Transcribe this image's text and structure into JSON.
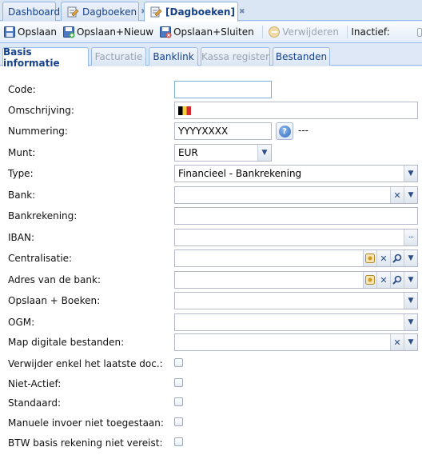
{
  "top_tabs": [
    {
      "label": "Dashboard"
    },
    {
      "label": "Dagboeken"
    },
    {
      "label": "[Dagboeken]"
    }
  ],
  "toolbar": {
    "save_label": "Opslaan",
    "save_new_label": "Opslaan+Nieuw",
    "save_close_label": "Opslaan+Sluiten",
    "delete_label": "Verwijderen",
    "inactive_label": "Inactief:"
  },
  "sub_tabs": [
    {
      "label": "Basis informatie"
    },
    {
      "label": "Facturatie"
    },
    {
      "label": "Banklink"
    },
    {
      "label": "Kassa register"
    },
    {
      "label": "Bestanden"
    }
  ],
  "form": {
    "code": {
      "label": "Code:",
      "value": ""
    },
    "omschrijving": {
      "label": "Omschrijving:",
      "value": ""
    },
    "nummering": {
      "label": "Nummering:",
      "value": "YYYYXXXX",
      "suffix": "---"
    },
    "munt": {
      "label": "Munt:",
      "value": "EUR"
    },
    "type": {
      "label": "Type:",
      "value": "Financieel - Bankrekening"
    },
    "bank": {
      "label": "Bank:",
      "value": ""
    },
    "bankrekening": {
      "label": "Bankrekening:",
      "value": ""
    },
    "iban": {
      "label": "IBAN:",
      "value": ""
    },
    "centralisatie": {
      "label": "Centralisatie:",
      "value": ""
    },
    "adres_bank": {
      "label": "Adres van de bank:",
      "value": ""
    },
    "opslaan_boeken": {
      "label": "Opslaan + Boeken:",
      "value": ""
    },
    "ogm": {
      "label": "OGM:",
      "value": ""
    },
    "map_digitale": {
      "label": "Map digitale bestanden:",
      "value": ""
    },
    "verwijder_laatste": {
      "label": "Verwijder enkel het laatste doc.:"
    },
    "niet_actief": {
      "label": "Niet-Actief:"
    },
    "standaard": {
      "label": "Standaard:"
    },
    "manuele_invoer": {
      "label": "Manuele invoer niet toegestaan:"
    },
    "btw_basis": {
      "label": "BTW basis rekening niet vereist:"
    }
  },
  "colors": {
    "accent": "#15428b",
    "border": "#99bbe8",
    "background": "#dfe8f6"
  }
}
